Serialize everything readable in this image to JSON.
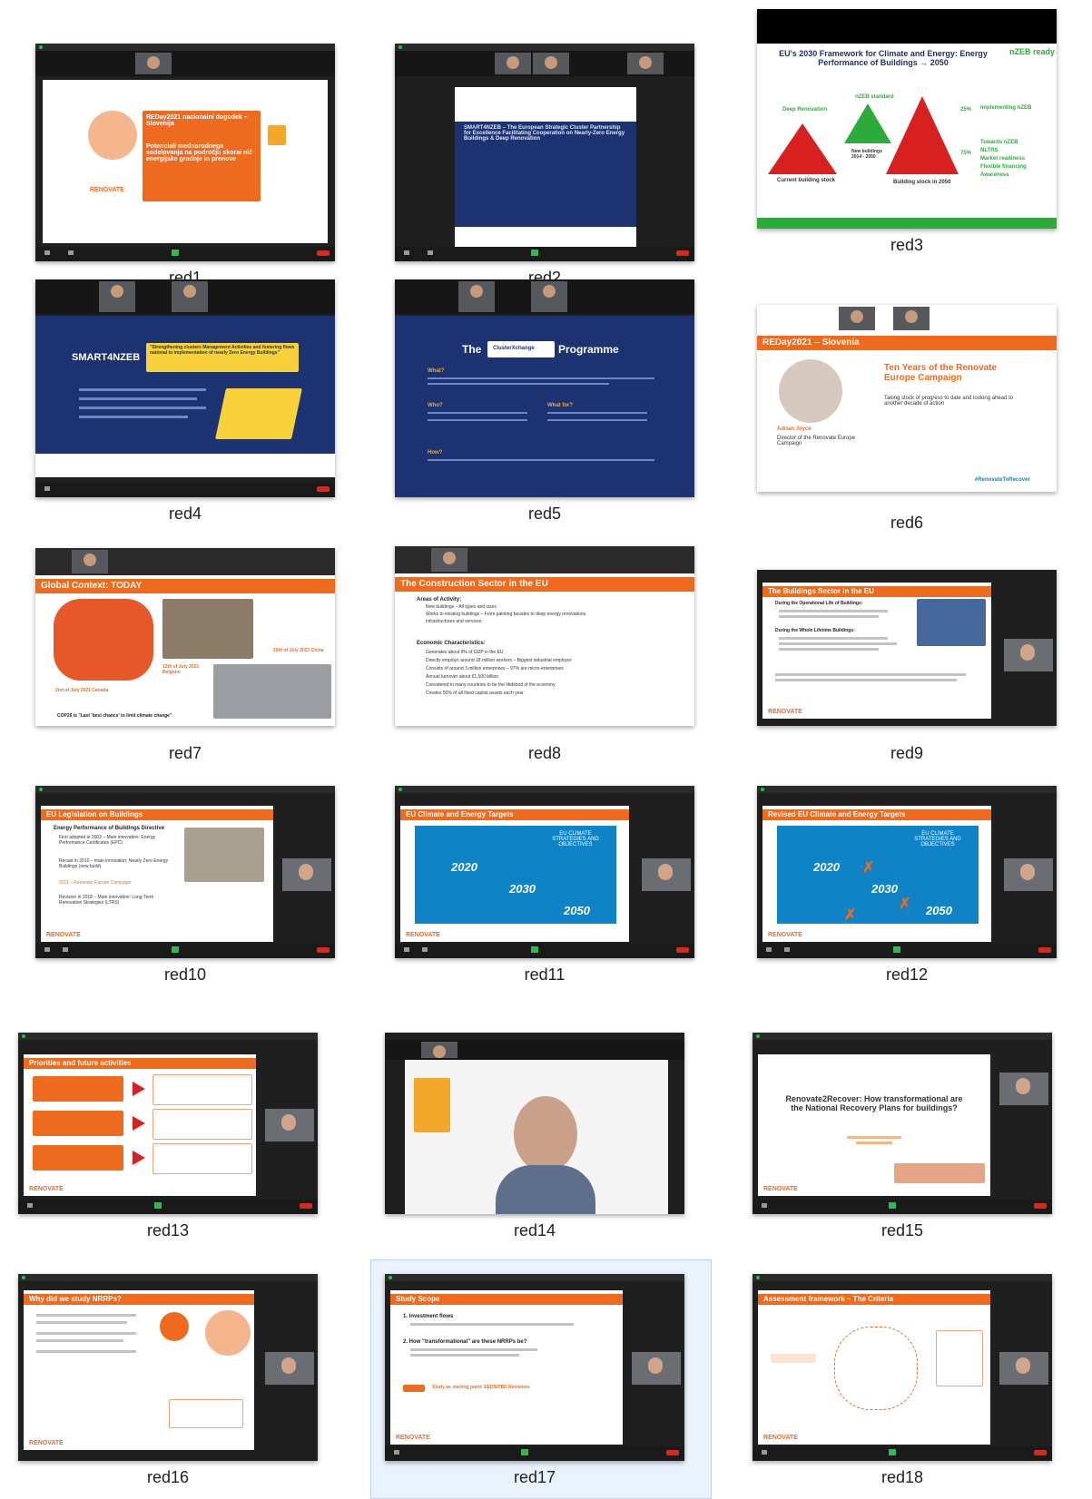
{
  "colors": {
    "zoom_dark": "#1f1f1f",
    "slide_orange": "#ee6a1f",
    "slide_blue": "#0f83c6",
    "navy": "#1d3270",
    "pyramid_green": "#2dab3a",
    "pyramid_red": "#d72020",
    "selection": "#eaf3fd"
  },
  "thumbnails": [
    {
      "label": "red1"
    },
    {
      "label": "red2"
    },
    {
      "label": "red3"
    },
    {
      "label": "red4"
    },
    {
      "label": "red5"
    },
    {
      "label": "red6"
    },
    {
      "label": "red7"
    },
    {
      "label": "red8"
    },
    {
      "label": "red9"
    },
    {
      "label": "red10"
    },
    {
      "label": "red11"
    },
    {
      "label": "red12"
    },
    {
      "label": "red13"
    },
    {
      "label": "red14"
    },
    {
      "label": "red15"
    },
    {
      "label": "red16"
    },
    {
      "label": "red17"
    },
    {
      "label": "red18"
    }
  ],
  "selected_label": "red17",
  "slides": {
    "red1": {
      "title": "REDay2021 nacionalni dogodek – Slovenija",
      "body": "Potenciali mednarodnega sodelovanja na področju skorai nič energijske gradnje in prenove",
      "logo": "RENOVATE"
    },
    "red2": {
      "title": "SMART4NZEB – The European Strategic Cluster Partnership for Excellence Facilitating Cooperation on Nearly-Zero Energy Buildings & Deep Renovation"
    },
    "red3": {
      "title": "EU's 2030 Framework for Climate and Energy: Energy Performance of Buildings → 2050",
      "badge": "nZEB ready",
      "left_label": "Deep Renovation",
      "mid_label": "nZEB standard",
      "stock_label": "Current building stock",
      "new_label": "New buildings 2014 - 2050",
      "future_label": "Building stock in 2050",
      "pct_top": "25%",
      "pct_bottom": "75%",
      "bullets": [
        "Implementing nZEB",
        "Towards nZEB",
        "NLTRS",
        "Market readiness",
        "Flexible financing",
        "Awareness"
      ]
    },
    "red4": {
      "brand": "SMART4NZEB",
      "title": "\"Strengthening clusters Management Activities and fostering flows national to implementation of nearly Zero Energy Buildings\""
    },
    "red5": {
      "title": "The",
      "brand": "ClusterXchange",
      "suffix": "Programme",
      "sections": [
        "What?",
        "Who?",
        "What for?",
        "How?"
      ]
    },
    "red6": {
      "title": "REDay2021 – Slovenia",
      "heading": "Ten Years of the Renovate Europe Campaign",
      "sub": "Taking stock of progress to date and looking ahead to another decade of action",
      "speaker": "Adrian Joyce",
      "role": "Director of the Renovate Europe Campaign",
      "hashtag": "#RenovateToRecover"
    },
    "red7": {
      "title": "Global Context: TODAY",
      "captions": [
        "2nd of July 2021 Canada",
        "12th of July 2021 Belgium",
        "20th of July 2021 China"
      ],
      "footer": "COP26 is \"Last 'best chance' to limit climate change\""
    },
    "red8": {
      "title": "The Construction Sector in the EU",
      "h1": "Areas of Activity:",
      "items1": [
        "New buildings – All types and sizes",
        "Works to existing buildings – From painting facades to deep energy renovations",
        "Infrastructures and services"
      ],
      "h2": "Economic Characteristics:",
      "items2": [
        "Generates about 9% of GDP in the EU",
        "Directly employs around 18 million workers – Biggest industrial employer",
        "Consists of around 3 million enterprises – 97% are micro-enterprises",
        "Annual turnover about €1,500 billion",
        "Considered in many countries to be the lifeblood of the economy",
        "Creates 50% of all fixed capital assets each year"
      ]
    },
    "red9": {
      "title": "The Buildings Sector in the EU",
      "h1": "During the Operational Life of Buildings:",
      "h2": "During the Whole Lifetime Buildings:"
    },
    "red10": {
      "title": "EU Legislation on Buildings",
      "h1": "Energy Performance of Buildings Directive",
      "items": [
        "First adopted in 2002 – Main innovation: Energy Performance Certificates (EPC)",
        "Recast in 2010 – main innovation: Nearly Zero Energy Buildings (new build)",
        "2011 – Renovate Europe Campaign",
        "Revision in 2018 – Main innovation: Long-Term Renovation Strategies (LTRS)"
      ]
    },
    "red11": {
      "title": "EU Climate and Energy Targets",
      "years": [
        "2020",
        "2030",
        "2050"
      ],
      "label": "EU CLIMATE STRATEGIES AND OBJECTIVES"
    },
    "red12": {
      "title": "Revised EU Climate and Energy Targets",
      "years": [
        "2020",
        "2030",
        "2050"
      ],
      "label": "EU CLIMATE STRATEGIES AND OBJECTIVES"
    },
    "red13": {
      "title": "Priorities and future activities"
    },
    "red15": {
      "title": "Renovate2Recover: How transformational are the National Recovery Plans for buildings?"
    },
    "red16": {
      "title": "Why did we study NRRPs?"
    },
    "red17": {
      "title": "Study Scope",
      "items": [
        "1. Investment flows",
        "2. How \"transformational\" are these NRRPs be?"
      ],
      "footer": "Study as starting point: EED/EPBD Revisions"
    },
    "red18": {
      "title": "Assessment framework – The Criteria"
    }
  }
}
